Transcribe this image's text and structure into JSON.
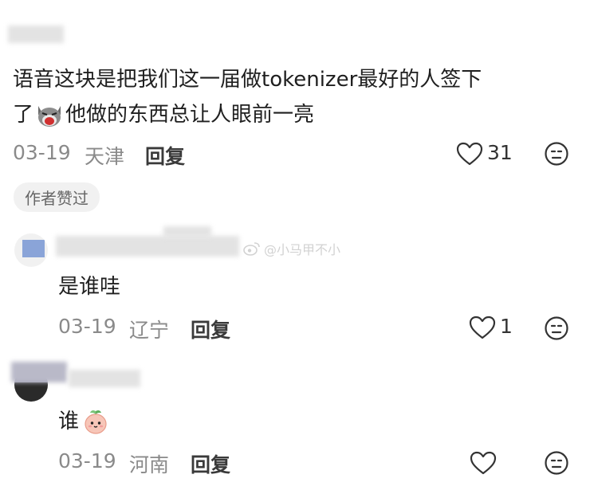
{
  "comment": {
    "text_line1": "语音这块是把我们这一届做tokenizer最好的人签下",
    "text_line2_prefix": "了",
    "text_line2_suffix": "他做的东西总让人眼前一亮",
    "emoji": "cat-crying-emoji",
    "date": "03-19",
    "location": "天津",
    "reply_label": "回复",
    "likes": "31",
    "author_liked_badge": "作者赞过"
  },
  "replies": [
    {
      "text": "是谁哇",
      "date": "03-19",
      "location": "辽宁",
      "reply_label": "回复",
      "likes": "1"
    },
    {
      "text": "谁",
      "emoji": "peach-face-emoji",
      "date": "03-19",
      "location": "河南",
      "reply_label": "回复",
      "likes": ""
    }
  ],
  "watermark": "@小马甲不小",
  "colors": {
    "text": "#1f1f1f",
    "meta": "#8a8a8a",
    "icon": "#333333"
  }
}
